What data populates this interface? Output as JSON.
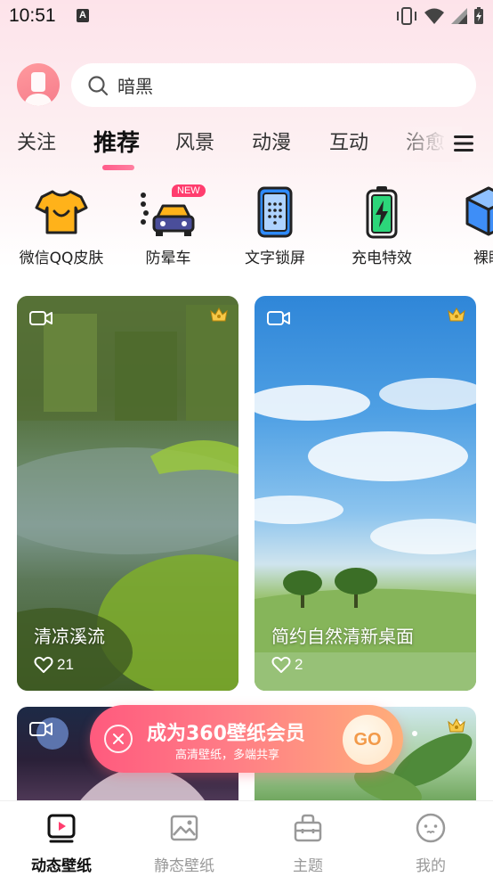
{
  "status_bar": {
    "time": "10:51",
    "badge": "A"
  },
  "search": {
    "placeholder": "暗黑"
  },
  "tabs": [
    {
      "label": "关注"
    },
    {
      "label": "推荐",
      "active": true
    },
    {
      "label": "风景"
    },
    {
      "label": "动漫"
    },
    {
      "label": "互动"
    },
    {
      "label": "治愈"
    }
  ],
  "shortcuts": [
    {
      "label": "微信QQ皮肤",
      "icon": "tshirt-icon"
    },
    {
      "label": "防晕车",
      "icon": "car-icon",
      "badge": "NEW"
    },
    {
      "label": "文字锁屏",
      "icon": "phone-keypad-icon"
    },
    {
      "label": "充电特效",
      "icon": "battery-charge-icon"
    },
    {
      "label": "裸眼",
      "icon": "cube-icon"
    }
  ],
  "cards": [
    {
      "title": "清凉溪流",
      "likes": "21"
    },
    {
      "title": "简约自然清新桌面",
      "likes": "2"
    },
    {
      "title": "",
      "likes": ""
    },
    {
      "title": "",
      "likes": ""
    }
  ],
  "promo": {
    "title": "成为360壁纸会员",
    "subtitle": "高清壁纸，多端共享",
    "cta": "GO"
  },
  "bottom_nav": [
    {
      "label": "动态壁纸",
      "active": true,
      "icon": "play-frame-icon"
    },
    {
      "label": "静态壁纸",
      "icon": "image-icon"
    },
    {
      "label": "主题",
      "icon": "theme-bag-icon"
    },
    {
      "label": "我的",
      "icon": "face-icon"
    }
  ],
  "colors": {
    "accent": "#ff4d7e",
    "promo_start": "#ff5a7e",
    "promo_end": "#ffae7a"
  }
}
